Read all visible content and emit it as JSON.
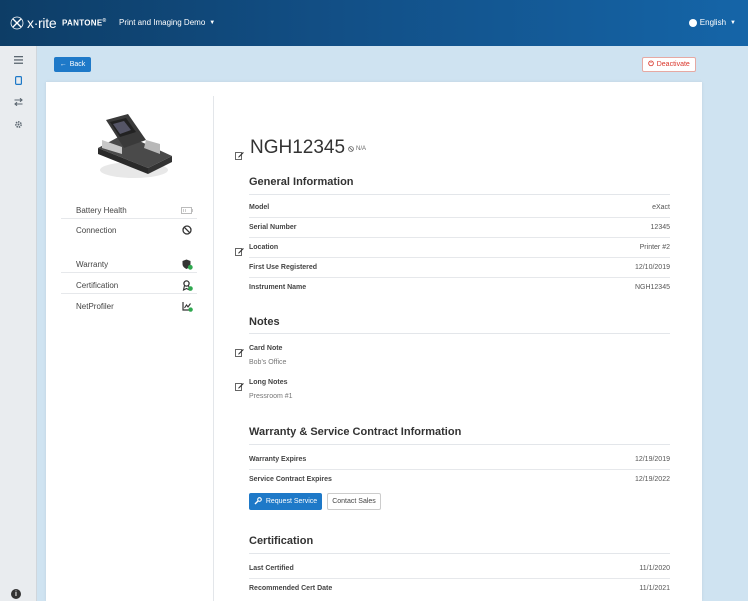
{
  "header": {
    "logo_text": "x·rite",
    "brand": "PANTONE",
    "brand_mark": "®",
    "org_name": "Print and Imaging Demo",
    "language": "English"
  },
  "sidebar": {
    "items": [
      {
        "icon": "menu-icon"
      },
      {
        "icon": "device-icon",
        "active": true
      },
      {
        "icon": "transfer-icon"
      },
      {
        "icon": "gear-icon"
      }
    ],
    "info_label": "i"
  },
  "actions": {
    "back_label": "Back",
    "deactivate_label": "Deactivate"
  },
  "device": {
    "name": "NGH12345",
    "status_badge": "N/A",
    "status_rows": [
      {
        "label": "Battery Health",
        "icon": "battery-icon"
      },
      {
        "label": "Connection",
        "icon": "no-connection-icon"
      },
      {
        "label": "Warranty",
        "icon": "shield-icon"
      },
      {
        "label": "Certification",
        "icon": "certificate-icon"
      },
      {
        "label": "NetProfiler",
        "icon": "chart-icon"
      }
    ]
  },
  "general": {
    "title": "General Information",
    "rows": [
      {
        "key": "Model",
        "value": "eXact"
      },
      {
        "key": "Serial Number",
        "value": "12345"
      },
      {
        "key": "Location",
        "value": "Printer #2"
      },
      {
        "key": "First Use Registered",
        "value": "12/10/2019"
      },
      {
        "key": "Instrument Name",
        "value": "NGH12345"
      }
    ]
  },
  "notes": {
    "title": "Notes",
    "card_note_label": "Card Note",
    "card_note_value": "Bob's Office",
    "long_notes_label": "Long Notes",
    "long_notes_value": "Pressroom #1"
  },
  "warranty": {
    "title": "Warranty & Service Contract Information",
    "rows": [
      {
        "key": "Warranty Expires",
        "value": "12/19/2019"
      },
      {
        "key": "Service Contract Expires",
        "value": "12/19/2022"
      }
    ],
    "request_label": "Request Service",
    "contact_label": "Contact Sales"
  },
  "certification": {
    "title": "Certification",
    "rows": [
      {
        "key": "Last Certified",
        "value": "11/1/2020"
      },
      {
        "key": "Recommended Cert Date",
        "value": "11/1/2021"
      }
    ]
  },
  "colors": {
    "primary": "#1e79c8",
    "header": "#124f86",
    "danger": "#d9362b",
    "success": "#2fa84f"
  }
}
